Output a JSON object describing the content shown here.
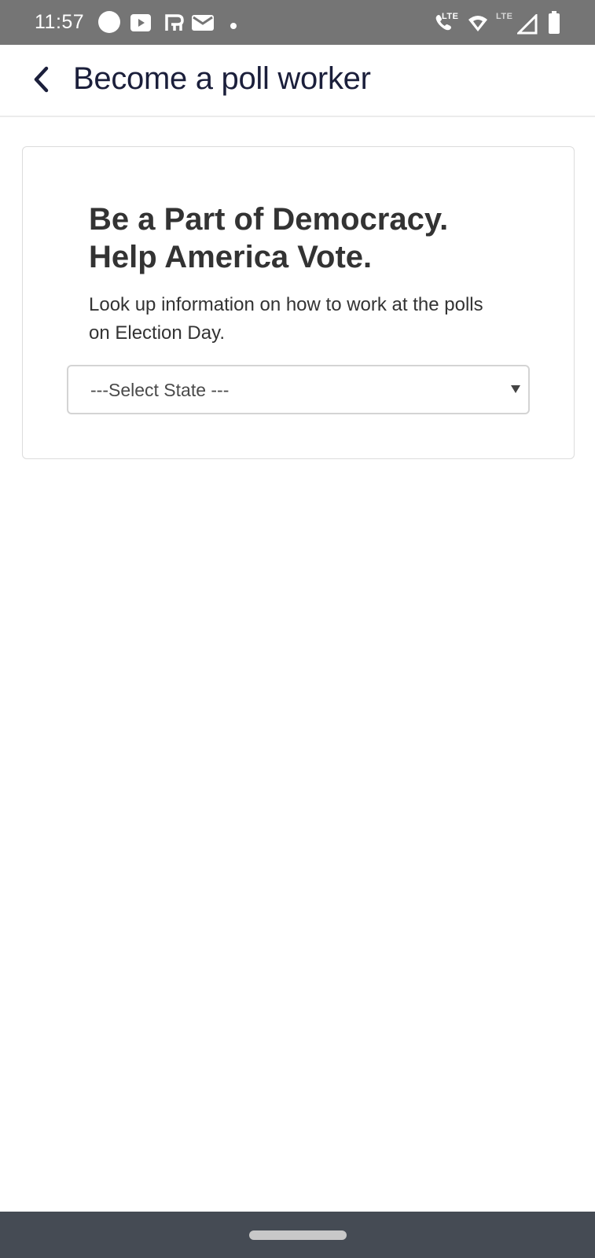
{
  "status_bar": {
    "time": "11:57",
    "left_icons": [
      "circle-icon",
      "youtube-icon",
      "r-app-icon",
      "gmail-icon",
      "dot-icon"
    ],
    "lte_call_label": "LTE",
    "lte_signal_label": "LTE",
    "right_icons": [
      "volte-call-icon",
      "wifi-icon",
      "signal-icon",
      "battery-icon"
    ]
  },
  "app_bar": {
    "title": "Become a poll worker",
    "back_icon": "chevron-left-icon"
  },
  "card": {
    "heading_line1": "Be a Part of Democracy.",
    "heading_line2": "Help America Vote.",
    "description": "Look up information on how to work at the polls on Election Day.",
    "state_select": {
      "selected": "---Select State ---",
      "arrow_icon": "triangle-down-icon"
    }
  },
  "colors": {
    "status_bar_bg": "#757575",
    "title_text": "#1b1f3b",
    "body_text": "#333333",
    "nav_bar_bg": "#454b54"
  }
}
